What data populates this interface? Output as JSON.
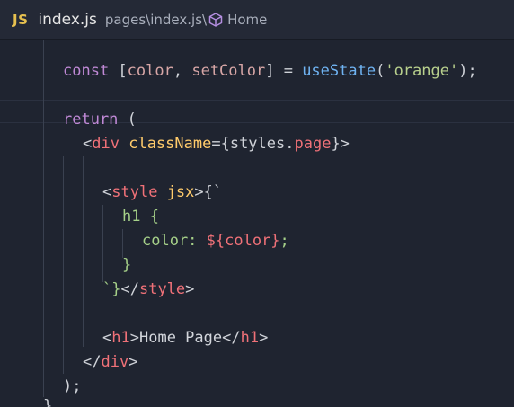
{
  "tab": {
    "badge": "JS",
    "file_name": "index.js",
    "path": "pages\\index.js\\",
    "symbol_icon": "cube-icon",
    "symbol": "Home",
    "badge_color": "#e6c04f"
  },
  "code": {
    "l1": {
      "kw": "const",
      "p1": " [",
      "a": "color",
      "comma": ", ",
      "b": "setColor",
      "p2": "] = ",
      "fn": "useState",
      "p3": "(",
      "str": "'orange'",
      "p4": ");"
    },
    "l3": {
      "kw": "return",
      "p": " ("
    },
    "l4": {
      "lt": "<",
      "tag": "div",
      "sp": " ",
      "attr": "className",
      "eq": "=",
      "p": "{styles.",
      "prop": "page",
      "gt": "}>"
    },
    "l6": {
      "lt": "<",
      "tag": "style",
      "sp": " ",
      "attr": "jsx",
      "rest": ">{`"
    },
    "l7": {
      "sel": "h1 {"
    },
    "l8": {
      "prop": "color: ",
      "interp": "${color}",
      "semi": ";"
    },
    "l9": {
      "close": "}"
    },
    "l10": {
      "bt": "`}",
      "lt": "</",
      "tag": "style",
      "gt": ">"
    },
    "l12": {
      "lt": "<",
      "tag1": "h1",
      "gt1": ">",
      "text": "Home Page",
      "lt2": "</",
      "tag2": "h1",
      "gt2": ">"
    },
    "l13": {
      "lt": "</",
      "tag": "div",
      "gt": ">"
    },
    "l14": {
      "p": ");"
    },
    "l15": {
      "p": "}"
    }
  }
}
